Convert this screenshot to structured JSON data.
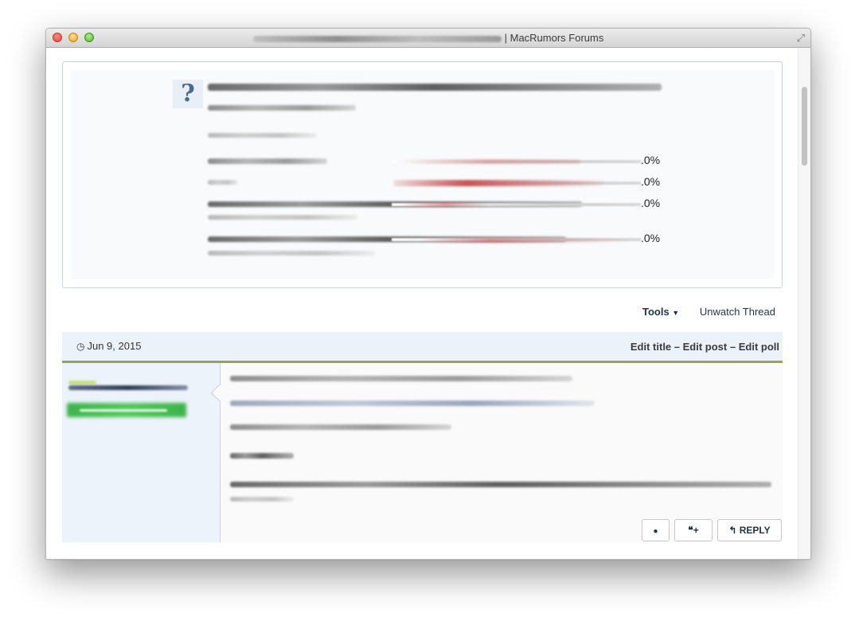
{
  "window": {
    "title": "| MacRumors Forums",
    "fullscreen_icon": "⤢"
  },
  "poll": {
    "icon": "?",
    "results": [
      {
        "percent": ".0%"
      },
      {
        "percent": ".0%"
      },
      {
        "percent": ".0%"
      },
      {
        "percent": ".0%"
      }
    ]
  },
  "toolbar": {
    "tools_label": "Tools",
    "tools_caret": "▼",
    "unwatch_label": "Unwatch Thread"
  },
  "post": {
    "date_icon": "◷",
    "date": "Jun 9, 2015",
    "actions": {
      "edit_title": "Edit title",
      "sep1": " – ",
      "edit_post": "Edit post",
      "sep2": " – ",
      "edit_poll": "Edit poll"
    },
    "buttons": {
      "report_icon": "●",
      "multiquote_icon": "❝+",
      "reply_icon": "↰",
      "reply_label": "REPLY"
    }
  },
  "colors": {
    "accent_green": "#95a94b",
    "header_bg": "#ecf2f9",
    "poll_bar": "#c0393b",
    "author_green": "#3cb44a"
  }
}
